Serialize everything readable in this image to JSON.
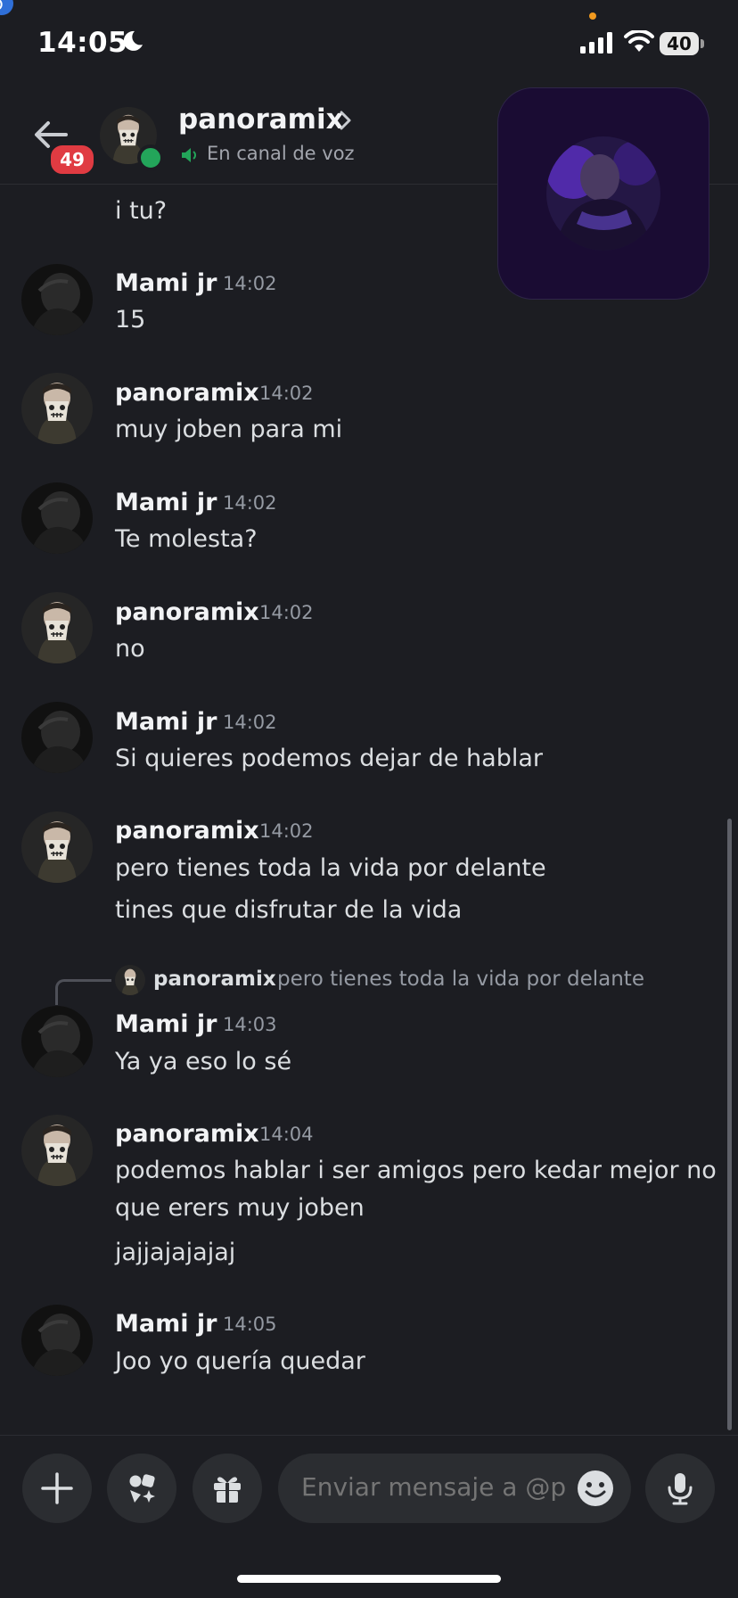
{
  "status_bar": {
    "time": "14:05",
    "battery": "40"
  },
  "header": {
    "name": "panoramix",
    "status": "En canal de voz",
    "unread_badge": "49"
  },
  "messages": [
    {
      "text": "i tu?"
    },
    {
      "author": "Mami jr",
      "time": "14:02",
      "lines": [
        "15"
      ]
    },
    {
      "author": "panoramix",
      "time": "14:02",
      "lines": [
        "muy joben para mi"
      ]
    },
    {
      "author": "Mami jr",
      "time": "14:02",
      "lines": [
        "Te molesta?"
      ]
    },
    {
      "author": "panoramix",
      "time": "14:02",
      "lines": [
        "no"
      ]
    },
    {
      "author": "Mami jr",
      "time": "14:02",
      "lines": [
        "Si quieres podemos dejar de hablar"
      ]
    },
    {
      "author": "panoramix",
      "time": "14:02",
      "lines": [
        "pero tienes toda la vida por delante",
        "tines que disfrutar de la vida"
      ]
    },
    {
      "author": "Mami jr",
      "time": "14:03",
      "lines": [
        "Ya ya eso lo sé"
      ],
      "reply": {
        "author": "panoramix",
        "text": "pero tienes toda la vida por delante"
      }
    },
    {
      "author": "panoramix",
      "time": "14:04",
      "lines": [
        "podemos hablar i ser amigos pero kedar mejor no",
        "que erers muy joben",
        "jajjajajajaj"
      ]
    },
    {
      "author": "Mami jr",
      "time": "14:05",
      "lines": [
        "Joo yo quería quedar"
      ]
    }
  ],
  "composer": {
    "placeholder": "Enviar mensaje a @p.."
  },
  "icons": {
    "back": "arrow-left-icon",
    "chevron": "chevron-right-icon",
    "speaker": "speaker-icon",
    "add": "plus-icon",
    "apps": "apps-icon",
    "gift": "gift-icon",
    "emoji": "emoji-icon",
    "mic": "microphone-icon"
  },
  "colors": {
    "background": "#1c1d22",
    "online": "#23a55a",
    "badge": "#e03b42",
    "call_bg": "#1a0c33"
  }
}
